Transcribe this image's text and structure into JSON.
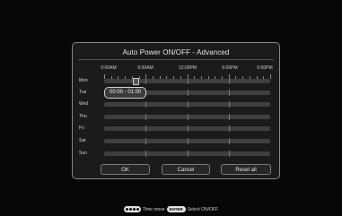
{
  "dialog": {
    "title": "Auto Power ON/OFF - Advanced",
    "time_labels": [
      "0:00AM",
      "6:00AM",
      "12:00PM",
      "6:00PM",
      "0:00PM"
    ],
    "days": [
      "Mon",
      "Tue",
      "Wed",
      "Thu",
      "Fri",
      "Sat",
      "Sun"
    ],
    "selected_day": "Mon",
    "selection_time": "00:00 - 01:00",
    "buttons": {
      "ok": "OK",
      "cancel": "Cancel",
      "reset": "Reset all"
    }
  },
  "hint": {
    "move_text": "Time move",
    "enter_key": "ENTER",
    "select_text": "Select ON/OFF"
  },
  "colors": {
    "background": "#070707",
    "dialog": "#1b1b1b",
    "track": "#3f3f3f"
  }
}
